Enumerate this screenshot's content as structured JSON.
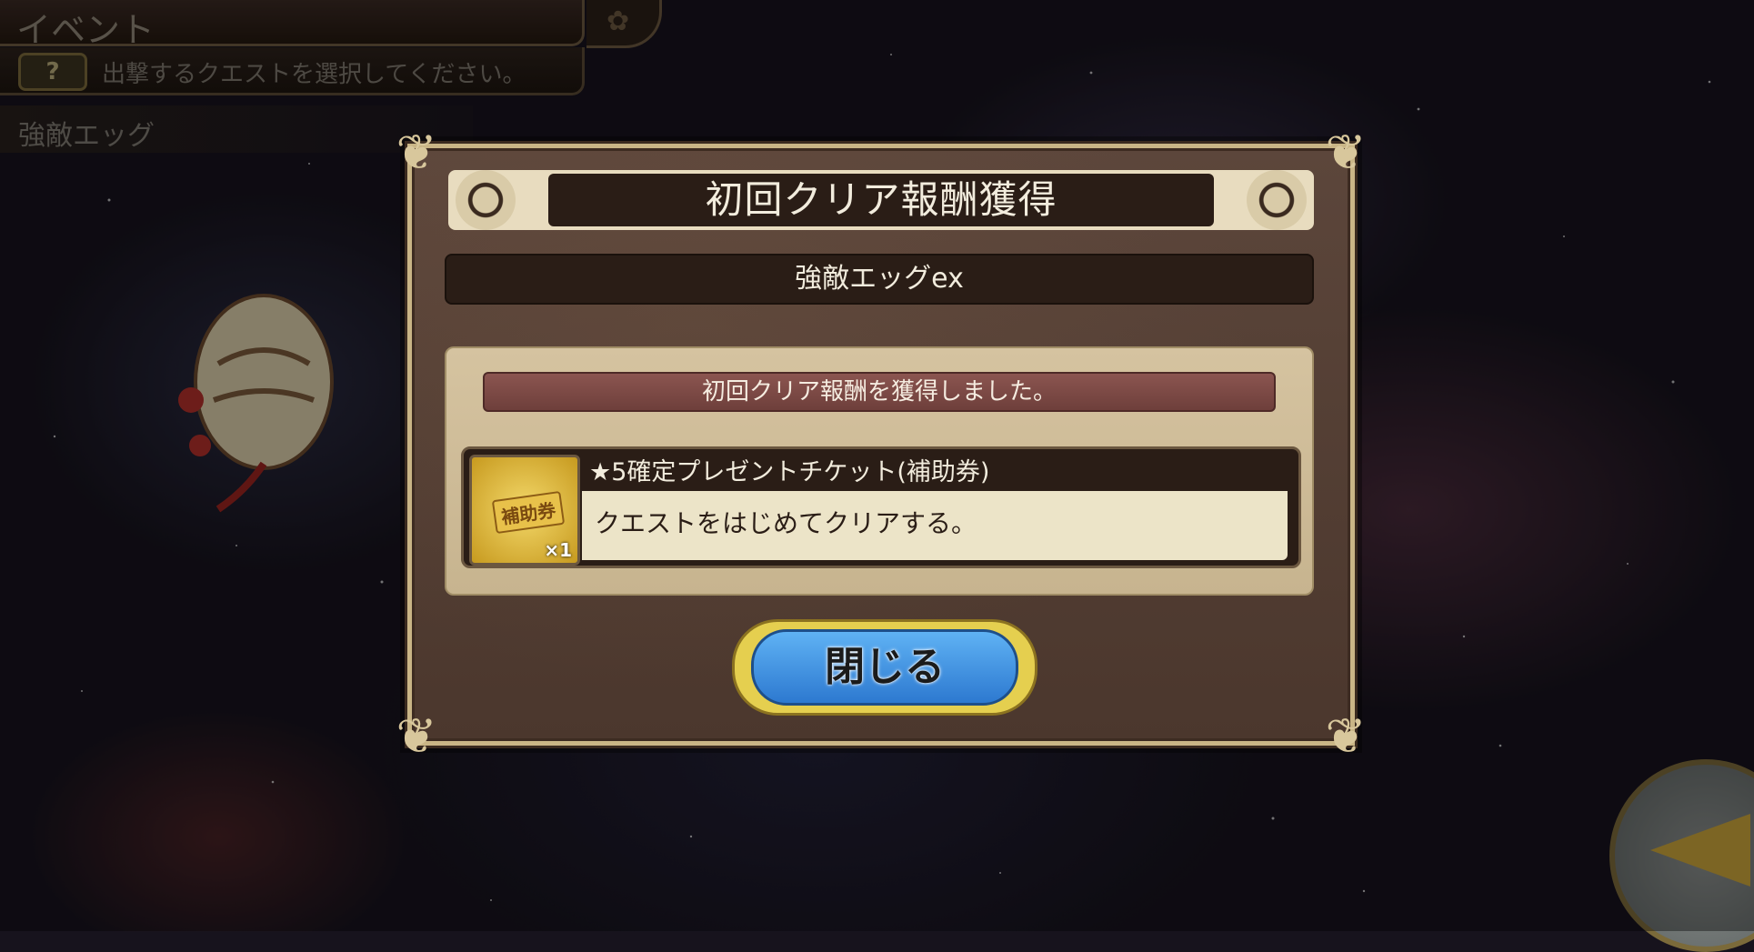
{
  "hud": {
    "title": "イベント",
    "help_icon": "?",
    "instruction": "出撃するクエストを選択してください。",
    "stage_name": "強敵エッグ"
  },
  "dialog": {
    "title": "初回クリア報酬獲得",
    "stage": "強敵エッグex",
    "notice": "初回クリア報酬を獲得しました。",
    "reward": {
      "icon_label": "補助券",
      "quantity": "×1",
      "name": "★5確定プレゼントチケット(補助券)",
      "description": "クエストをはじめてクリアする。"
    },
    "close_label": "閉じる"
  },
  "colors": {
    "dialog_bg": "#4b372d",
    "title_bar": "#2a1d16",
    "notice_bar": "#7a4743",
    "close_button": "#2d79d0",
    "gold_accent": "#e5cf4f"
  },
  "icons": [
    "help-icon",
    "back-arrow-icon",
    "ticket-icon"
  ]
}
